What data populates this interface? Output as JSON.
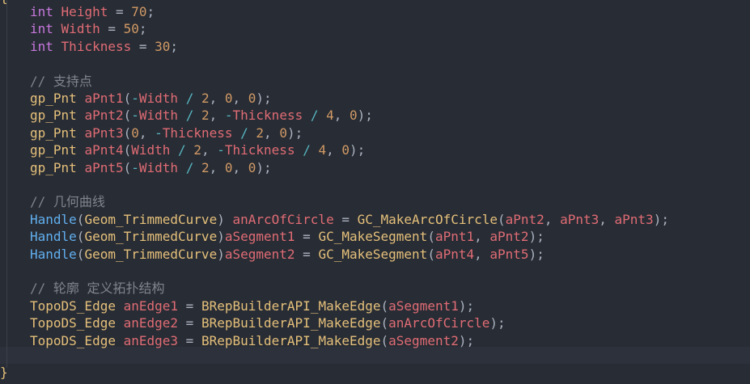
{
  "editor": {
    "brace_open": "{",
    "brace_close": "}",
    "colors": {
      "background": "#282c34",
      "keyword": "#c678dd",
      "variable": "#e06c75",
      "number": "#d19a66",
      "operator": "#56b6c2",
      "type": "#e5c07b",
      "function": "#61afef",
      "comment": "#7f848e"
    },
    "lines": [
      [
        {
          "t": "int",
          "c": "kw"
        },
        {
          "t": " ",
          "c": "pun"
        },
        {
          "t": "Height",
          "c": "var"
        },
        {
          "t": " = ",
          "c": "pun"
        },
        {
          "t": "70",
          "c": "num"
        },
        {
          "t": ";",
          "c": "pun"
        }
      ],
      [
        {
          "t": "int",
          "c": "kw"
        },
        {
          "t": " ",
          "c": "pun"
        },
        {
          "t": "Width",
          "c": "var"
        },
        {
          "t": " = ",
          "c": "pun"
        },
        {
          "t": "50",
          "c": "num"
        },
        {
          "t": ";",
          "c": "pun"
        }
      ],
      [
        {
          "t": "int",
          "c": "kw"
        },
        {
          "t": " ",
          "c": "pun"
        },
        {
          "t": "Thickness",
          "c": "var"
        },
        {
          "t": " = ",
          "c": "pun"
        },
        {
          "t": "30",
          "c": "num"
        },
        {
          "t": ";",
          "c": "pun"
        }
      ],
      [],
      [
        {
          "t": "// 支持点",
          "c": "cm"
        }
      ],
      [
        {
          "t": "gp_Pnt",
          "c": "typ"
        },
        {
          "t": " ",
          "c": "pun"
        },
        {
          "t": "aPnt1",
          "c": "var"
        },
        {
          "t": "(",
          "c": "pun"
        },
        {
          "t": "-",
          "c": "op"
        },
        {
          "t": "Width",
          "c": "var"
        },
        {
          "t": " / ",
          "c": "op"
        },
        {
          "t": "2",
          "c": "num"
        },
        {
          "t": ", ",
          "c": "pun"
        },
        {
          "t": "0",
          "c": "num"
        },
        {
          "t": ", ",
          "c": "pun"
        },
        {
          "t": "0",
          "c": "num"
        },
        {
          "t": ");",
          "c": "pun"
        }
      ],
      [
        {
          "t": "gp_Pnt",
          "c": "typ"
        },
        {
          "t": " ",
          "c": "pun"
        },
        {
          "t": "aPnt2",
          "c": "var"
        },
        {
          "t": "(",
          "c": "pun"
        },
        {
          "t": "-",
          "c": "op"
        },
        {
          "t": "Width",
          "c": "var"
        },
        {
          "t": " / ",
          "c": "op"
        },
        {
          "t": "2",
          "c": "num"
        },
        {
          "t": ", ",
          "c": "pun"
        },
        {
          "t": "-",
          "c": "op"
        },
        {
          "t": "Thickness",
          "c": "var"
        },
        {
          "t": " / ",
          "c": "op"
        },
        {
          "t": "4",
          "c": "num"
        },
        {
          "t": ", ",
          "c": "pun"
        },
        {
          "t": "0",
          "c": "num"
        },
        {
          "t": ");",
          "c": "pun"
        }
      ],
      [
        {
          "t": "gp_Pnt",
          "c": "typ"
        },
        {
          "t": " ",
          "c": "pun"
        },
        {
          "t": "aPnt3",
          "c": "var"
        },
        {
          "t": "(",
          "c": "pun"
        },
        {
          "t": "0",
          "c": "num"
        },
        {
          "t": ", ",
          "c": "pun"
        },
        {
          "t": "-",
          "c": "op"
        },
        {
          "t": "Thickness",
          "c": "var"
        },
        {
          "t": " / ",
          "c": "op"
        },
        {
          "t": "2",
          "c": "num"
        },
        {
          "t": ", ",
          "c": "pun"
        },
        {
          "t": "0",
          "c": "num"
        },
        {
          "t": ");",
          "c": "pun"
        }
      ],
      [
        {
          "t": "gp_Pnt",
          "c": "typ"
        },
        {
          "t": " ",
          "c": "pun"
        },
        {
          "t": "aPnt4",
          "c": "var"
        },
        {
          "t": "(",
          "c": "pun"
        },
        {
          "t": "Width",
          "c": "var"
        },
        {
          "t": " / ",
          "c": "op"
        },
        {
          "t": "2",
          "c": "num"
        },
        {
          "t": ", ",
          "c": "pun"
        },
        {
          "t": "-",
          "c": "op"
        },
        {
          "t": "Thickness",
          "c": "var"
        },
        {
          "t": " / ",
          "c": "op"
        },
        {
          "t": "4",
          "c": "num"
        },
        {
          "t": ", ",
          "c": "pun"
        },
        {
          "t": "0",
          "c": "num"
        },
        {
          "t": ");",
          "c": "pun"
        }
      ],
      [
        {
          "t": "gp_Pnt",
          "c": "typ"
        },
        {
          "t": " ",
          "c": "pun"
        },
        {
          "t": "aPnt5",
          "c": "var"
        },
        {
          "t": "(",
          "c": "pun"
        },
        {
          "t": "-",
          "c": "op"
        },
        {
          "t": "Width",
          "c": "var"
        },
        {
          "t": " / ",
          "c": "op"
        },
        {
          "t": "2",
          "c": "num"
        },
        {
          "t": ", ",
          "c": "pun"
        },
        {
          "t": "0",
          "c": "num"
        },
        {
          "t": ", ",
          "c": "pun"
        },
        {
          "t": "0",
          "c": "num"
        },
        {
          "t": ");",
          "c": "pun"
        }
      ],
      [],
      [
        {
          "t": "// 几何曲线",
          "c": "cm"
        }
      ],
      [
        {
          "t": "Handle",
          "c": "fn"
        },
        {
          "t": "(",
          "c": "pun"
        },
        {
          "t": "Geom_TrimmedCurve",
          "c": "typ"
        },
        {
          "t": ") ",
          "c": "pun"
        },
        {
          "t": "anArcOfCircle",
          "c": "var"
        },
        {
          "t": " = ",
          "c": "pun"
        },
        {
          "t": "GC_MakeArcOfCircle",
          "c": "typ"
        },
        {
          "t": "(",
          "c": "pun"
        },
        {
          "t": "aPnt2",
          "c": "var"
        },
        {
          "t": ", ",
          "c": "pun"
        },
        {
          "t": "aPnt3",
          "c": "var"
        },
        {
          "t": ", ",
          "c": "pun"
        },
        {
          "t": "aPnt3",
          "c": "var"
        },
        {
          "t": ");",
          "c": "pun"
        }
      ],
      [
        {
          "t": "Handle",
          "c": "fn"
        },
        {
          "t": "(",
          "c": "pun"
        },
        {
          "t": "Geom_TrimmedCurve",
          "c": "typ"
        },
        {
          "t": ")",
          "c": "pun"
        },
        {
          "t": "aSegment1",
          "c": "var"
        },
        {
          "t": " = ",
          "c": "pun"
        },
        {
          "t": "GC_MakeSegment",
          "c": "typ"
        },
        {
          "t": "(",
          "c": "pun"
        },
        {
          "t": "aPnt1",
          "c": "var"
        },
        {
          "t": ", ",
          "c": "pun"
        },
        {
          "t": "aPnt2",
          "c": "var"
        },
        {
          "t": ");",
          "c": "pun"
        }
      ],
      [
        {
          "t": "Handle",
          "c": "fn"
        },
        {
          "t": "(",
          "c": "pun"
        },
        {
          "t": "Geom_TrimmedCurve",
          "c": "typ"
        },
        {
          "t": ")",
          "c": "pun"
        },
        {
          "t": "aSegment2",
          "c": "var"
        },
        {
          "t": " = ",
          "c": "pun"
        },
        {
          "t": "GC_MakeSegment",
          "c": "typ"
        },
        {
          "t": "(",
          "c": "pun"
        },
        {
          "t": "aPnt4",
          "c": "var"
        },
        {
          "t": ", ",
          "c": "pun"
        },
        {
          "t": "aPnt5",
          "c": "var"
        },
        {
          "t": ");",
          "c": "pun"
        }
      ],
      [],
      [
        {
          "t": "// 轮廓 定义拓扑结构",
          "c": "cm"
        }
      ],
      [
        {
          "t": "TopoDS_Edge",
          "c": "typ"
        },
        {
          "t": " ",
          "c": "pun"
        },
        {
          "t": "anEdge1",
          "c": "var"
        },
        {
          "t": " = ",
          "c": "pun"
        },
        {
          "t": "BRepBuilderAPI_MakeEdge",
          "c": "typ"
        },
        {
          "t": "(",
          "c": "pun"
        },
        {
          "t": "aSegment1",
          "c": "var"
        },
        {
          "t": ");",
          "c": "pun"
        }
      ],
      [
        {
          "t": "TopoDS_Edge",
          "c": "typ"
        },
        {
          "t": " ",
          "c": "pun"
        },
        {
          "t": "anEdge2",
          "c": "var"
        },
        {
          "t": " = ",
          "c": "pun"
        },
        {
          "t": "BRepBuilderAPI_MakeEdge",
          "c": "typ"
        },
        {
          "t": "(",
          "c": "pun"
        },
        {
          "t": "anArcOfCircle",
          "c": "var"
        },
        {
          "t": ");",
          "c": "pun"
        }
      ],
      [
        {
          "t": "TopoDS_Edge",
          "c": "typ"
        },
        {
          "t": " ",
          "c": "pun"
        },
        {
          "t": "anEdge3",
          "c": "var"
        },
        {
          "t": " = ",
          "c": "pun"
        },
        {
          "t": "BRepBuilderAPI_MakeEdge",
          "c": "typ"
        },
        {
          "t": "(",
          "c": "pun"
        },
        {
          "t": "aSegment2",
          "c": "var"
        },
        {
          "t": ");",
          "c": "pun"
        }
      ]
    ]
  }
}
